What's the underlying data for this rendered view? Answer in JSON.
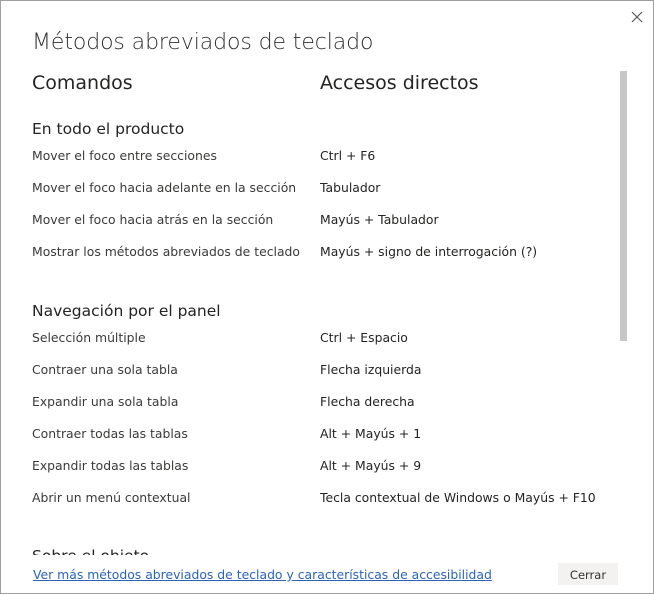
{
  "dialog": {
    "title": "Métodos abreviados de teclado",
    "close_icon": "close-icon"
  },
  "columns": {
    "commands": "Comandos",
    "shortcuts": "Accesos directos"
  },
  "sections": [
    {
      "title": "En todo el producto",
      "rows": [
        {
          "command": "Mover el foco entre secciones",
          "shortcut": "Ctrl + F6"
        },
        {
          "command": "Mover el foco hacia adelante en la sección",
          "shortcut": "Tabulador"
        },
        {
          "command": "Mover el foco hacia atrás en la sección",
          "shortcut": "Mayús + Tabulador"
        },
        {
          "command": "Mostrar los métodos abreviados de teclado",
          "shortcut": "Mayús + signo de interrogación (?)"
        }
      ]
    },
    {
      "title": "Navegación por el panel",
      "rows": [
        {
          "command": "Selección múltiple",
          "shortcut": "Ctrl + Espacio"
        },
        {
          "command": "Contraer una sola tabla",
          "shortcut": "Flecha izquierda"
        },
        {
          "command": "Expandir una sola tabla",
          "shortcut": "Flecha derecha"
        },
        {
          "command": "Contraer todas las tablas",
          "shortcut": "Alt + Mayús + 1"
        },
        {
          "command": "Expandir todas las tablas",
          "shortcut": "Alt + Mayús + 9"
        },
        {
          "command": "Abrir un menú contextual",
          "shortcut": "Tecla contextual de Windows o Mayús + F10"
        }
      ]
    },
    {
      "title": "Sobre el objeto",
      "rows": []
    }
  ],
  "footer": {
    "link_text": "Ver más métodos abreviados de teclado y características de accesibilidad",
    "close_button_label": "Cerrar"
  },
  "colors": {
    "link": "#2b63b8",
    "scrollbar_thumb": "#c8c6c4",
    "button_bg": "#f3f2f1",
    "border": "#a19f9d"
  }
}
